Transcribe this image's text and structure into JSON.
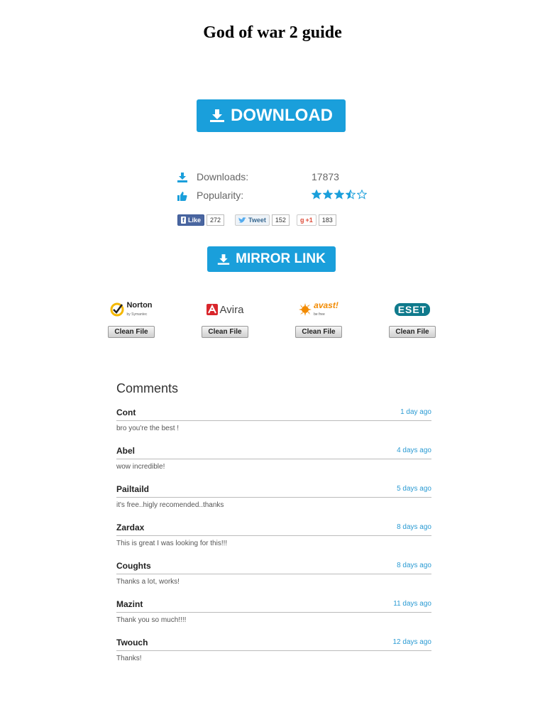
{
  "title": "God of war 2 guide",
  "download_button": {
    "label": "DOWNLOAD"
  },
  "stats": {
    "downloads": {
      "label": "Downloads:",
      "value": "17873"
    },
    "popularity": {
      "label": "Popularity:",
      "rating": 3.5,
      "max": 5
    }
  },
  "social": {
    "facebook": {
      "label": "Like",
      "count": "272"
    },
    "twitter": {
      "label": "Tweet",
      "count": "152"
    },
    "gplus": {
      "label": "+1",
      "count": "183"
    }
  },
  "mirror_button": {
    "label": "MIRROR LINK"
  },
  "antivirus": [
    {
      "name": "Norton",
      "sub": "by Symantec",
      "badge": "Clean File"
    },
    {
      "name": "Avira",
      "badge": "Clean File"
    },
    {
      "name": "avast!",
      "sub": "be free",
      "badge": "Clean File"
    },
    {
      "name": "eset",
      "badge": "Clean File"
    }
  ],
  "comments": {
    "heading": "Comments",
    "items": [
      {
        "author": "Cont",
        "time": "1 day ago",
        "text": "bro you're the best !"
      },
      {
        "author": "Abel",
        "time": "4 days ago",
        "text": "wow incredible!"
      },
      {
        "author": "Pailtaild",
        "time": "5 days ago",
        "text": "it's free..higly recomended..thanks"
      },
      {
        "author": "Zardax",
        "time": "8 days ago",
        "text": "This is great I was looking for this!!!"
      },
      {
        "author": "Coughts",
        "time": "8 days ago",
        "text": "Thanks a lot, works!"
      },
      {
        "author": "Mazint",
        "time": "11 days ago",
        "text": "Thank you so much!!!!"
      },
      {
        "author": "Twouch",
        "time": "12 days ago",
        "text": "Thanks!"
      }
    ]
  },
  "colors": {
    "accent": "#1a9fdb",
    "star": "#1a9fdb",
    "link": "#2b9bd3"
  }
}
